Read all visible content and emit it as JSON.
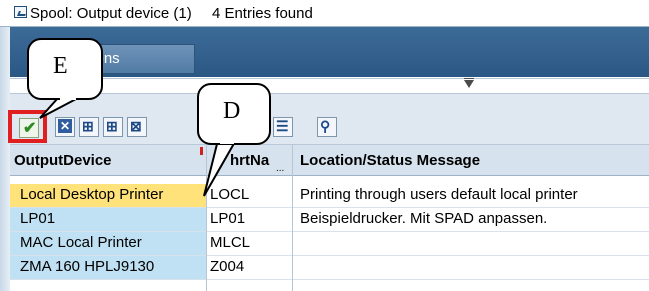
{
  "window": {
    "title": "Spool: Output device (1)",
    "entries_found": "4 Entries found"
  },
  "tabs": [
    {
      "label": "trictions"
    }
  ],
  "toolbar": {
    "buttons": [
      {
        "icon": "checkmark-icon",
        "symbol": "✔"
      },
      {
        "icon": "cancel-icon",
        "symbol": "✕"
      },
      {
        "icon": "find-icon",
        "symbol": "⊞"
      },
      {
        "icon": "find-next-icon",
        "symbol": "⊞"
      },
      {
        "icon": "grid-icon",
        "symbol": "⊠"
      },
      {
        "icon": "list-icon",
        "symbol": "☰"
      },
      {
        "icon": "info-icon",
        "symbol": "⚲"
      }
    ]
  },
  "table": {
    "headers": [
      "OutputDevice",
      "hrtNa",
      "Location/Status Message"
    ],
    "rows": [
      {
        "device": "Local Desktop Printer",
        "short": "LOCL",
        "message": "Printing through users default local printer"
      },
      {
        "device": "LP01",
        "short": "LP01",
        "message": "Beispieldrucker. Mit SPAD anpassen."
      },
      {
        "device": "MAC Local Printer",
        "short": "MLCL",
        "message": ""
      },
      {
        "device": "ZMA 160 HPLJ9130",
        "short": "Z004",
        "message": ""
      }
    ],
    "selected_row": 0,
    "header_ellipsis": "..."
  },
  "callouts": {
    "e": "E",
    "d": "D"
  },
  "colors": {
    "highlight": "#e02020",
    "selected_row": "#ffe27a",
    "key_column": "#bfe1f3",
    "band": "#2b5784"
  }
}
